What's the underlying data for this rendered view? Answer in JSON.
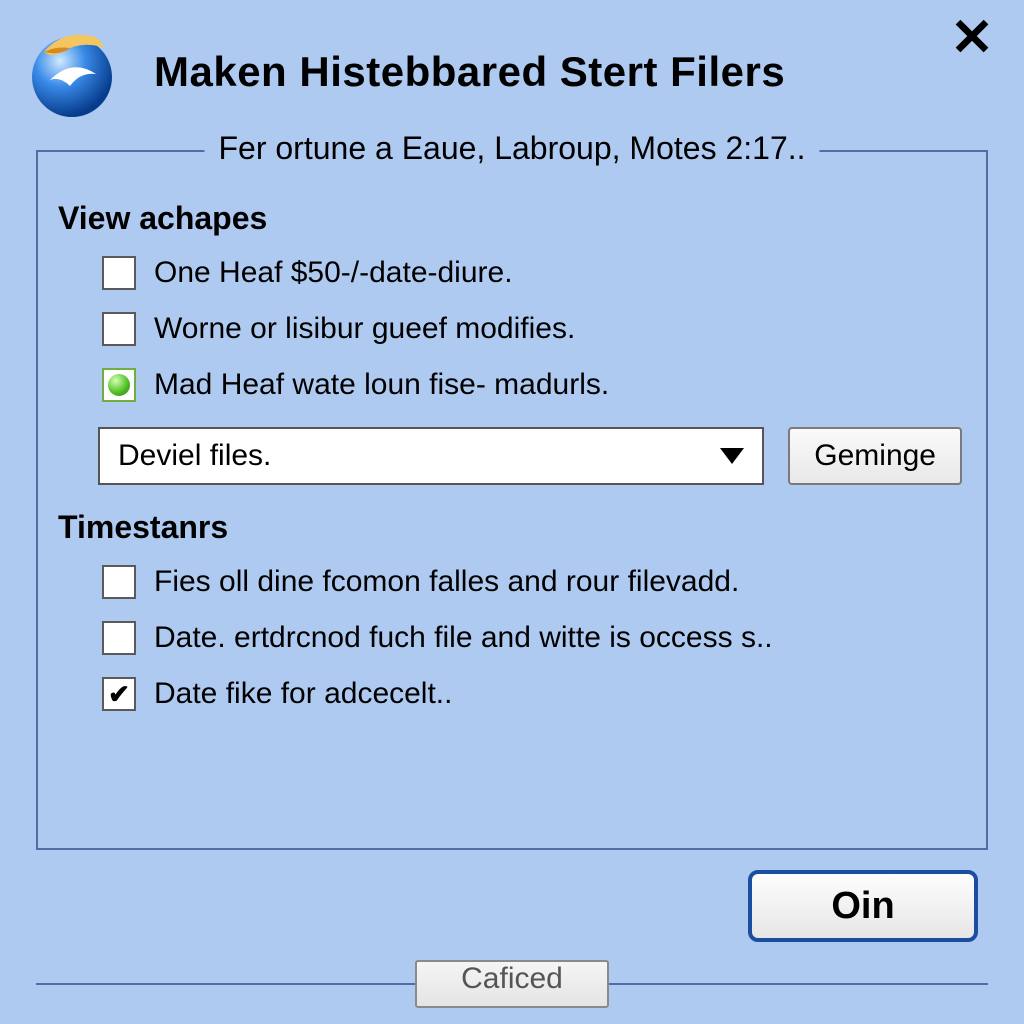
{
  "header": {
    "title": "Maken Histebbared Stert Filers"
  },
  "group": {
    "legend": "Fer ortune a Eaue, Labroup, Motes 2:17..",
    "section1": {
      "title": "View achapes",
      "options": [
        {
          "label": "One Heaf $50-/-date-diure.",
          "checked": false
        },
        {
          "label": "Worne or lisibur gueef modifies.",
          "checked": false
        },
        {
          "label": "Mad Heaf wate loun fise- madurls.",
          "checked": true
        }
      ],
      "dropdown_value": "Deviel files.",
      "side_button": "Geminge"
    },
    "section2": {
      "title": "Timestanrs",
      "options": [
        {
          "label": "Fies oll dine fcomon falles and rour filevadd.",
          "checked": false
        },
        {
          "label": "Date. ertdrcnod fuch file and witte is occess s..",
          "checked": false
        },
        {
          "label": "Date fike for adcecelt..",
          "checked": true
        }
      ]
    }
  },
  "buttons": {
    "primary": "Oin",
    "footer": "Caficed"
  }
}
